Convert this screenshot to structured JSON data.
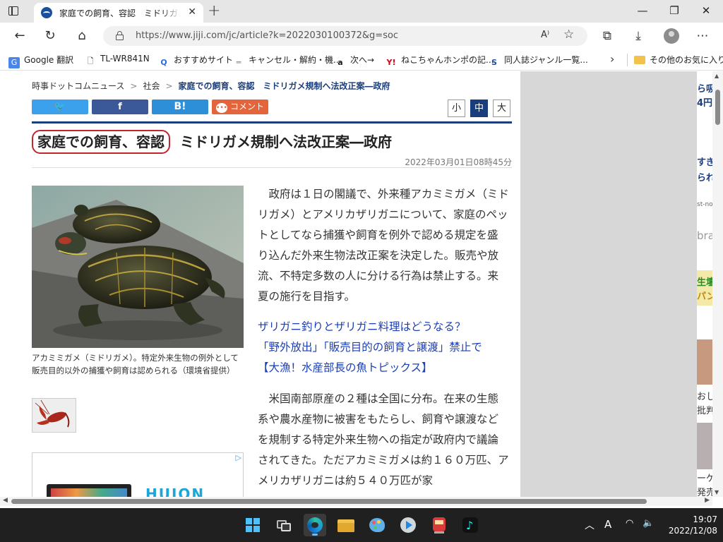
{
  "browser": {
    "tab_title": "家庭での飼育、容認　ミドリガメ規制",
    "address_url": "https://www.jiji.com/jc/article?k=2022030100372&g=soc",
    "readaloud_glyph": "A⁾",
    "favorites": [
      {
        "label": "Google 翻訳",
        "icon": "google-translate-icon"
      },
      {
        "label": "TL-WR841N",
        "icon": "page-icon"
      },
      {
        "label": "おすすめサイト",
        "icon": "search-icon"
      },
      {
        "label": "キャンセル・解約・機...",
        "icon": "list-icon"
      },
      {
        "label": "次へ→",
        "icon": "amazon-icon"
      },
      {
        "label": "ねこちゃんホンポの記...",
        "icon": "yahoo-icon"
      },
      {
        "label": "同人誌ジャンル一覧...",
        "icon": "s-icon"
      }
    ],
    "favorites_other": "その他のお気に入り"
  },
  "article": {
    "breadcrumb": [
      "時事ドットコムニュース",
      "社会",
      "家庭での飼育、容認　ミドリガメ規制へ法改正案―政府"
    ],
    "share": {
      "twitter": "🐦",
      "facebook": "f",
      "hatena": "B!",
      "comment": "コメント"
    },
    "font_sizes": [
      "小",
      "中",
      "大"
    ],
    "title_highlight": "家庭での飼育、容認",
    "title_rest": "ミドリガメ規制へ法改正案―政府",
    "date": "2022年03月01日08時45分",
    "caption": "アカミミガメ（ミドリガメ）。特定外来生物の例外として販売目的以外の捕獲や飼育は認められる（環境省提供）",
    "paragraph1": "政府は１日の閣議で、外来種アカミミガメ（ミドリガメ）とアメリカザリガニについて、家庭のペットとしてなら捕獲や飼育を例外で認める規定を盛り込んだ外来生物法改正案を決定した。販売や放流、不特定多数の人に分ける行為は禁止する。来夏の施行を目指す。",
    "related_links": [
      "ザリガニ釣りとザリガニ料理はどうなる？",
      "「野外放出」「販売目的の飼育と譲渡」禁止で",
      "【大漁！水産部長の魚トピックス】"
    ],
    "paragraph2": "米国南部原産の２種は全国に分布。在来の生態系や農水産物に被害をもたらし、飼育や譲渡などを規制する特定外来生物への指定が政府内で議論されてきた。ただアカミミガメは約１６０万匹、アメリカザリガニは約５４０万匹が家",
    "ad_brand": "HUION"
  },
  "sidebar_fragments": [
    "ら吸",
    "4円",
    "すぎ",
    "られ",
    "st-not",
    "bra",
    "生壇",
    "パン",
    "おし",
    "批判",
    "ーケ",
    "発売"
  ],
  "taskbar": {
    "time": "19:07",
    "date": "2022/12/08",
    "ime": "A"
  },
  "colors": {
    "accent_navy": "#1a3d7c",
    "highlight_red": "#c0262e",
    "link_blue": "#1a3fb8"
  }
}
